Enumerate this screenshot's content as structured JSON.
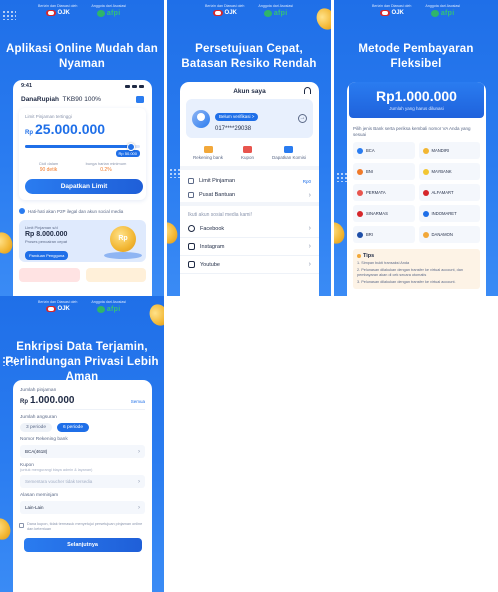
{
  "logos": {
    "ojk_caption": "Berizin dan Diawasi oleh",
    "ojk_text": "OJK",
    "afpi_caption": "Anggota dari Asosiasi",
    "afpi_text": "afpi"
  },
  "colors": {
    "accent": "#1f6fe8",
    "panel_bg": "#2a7cf0",
    "warning": "#f07a2a",
    "afpi_green": "#34c278",
    "coin": "#f2b632"
  },
  "panel1": {
    "headline_1": "Aplikasi Online Mudah dan",
    "headline_2": "Nyaman",
    "status_time": "9:41",
    "app_name": "DanaRupiah",
    "app_code": "TKB90 100%",
    "limit_label": "Limit Pinjaman tertinggi",
    "currency": "Rp",
    "limit_value": "25.000.000",
    "slider_max": "Rp 50.000",
    "slider_fraction": 0.92,
    "stat_left_label": "Cicil dalam",
    "stat_left_value": "90 detik",
    "stat_right_label": "bunga harian minimum",
    "stat_right_value": "0.2%",
    "button": "Dapatkan Limit",
    "notice": "Hati-hati akan P2P ilegal dan akun social media",
    "promo_label": "Limit Pinjaman s/d",
    "promo_value": "Rp 8.000.000",
    "promo_sub": "Proses pencairan cepat",
    "promo_button": "Panduan Pengguna",
    "promo_badge": "Rp"
  },
  "panel2": {
    "headline_1": "Persetujuan Cepat,",
    "headline_2": "Batasan Resiko Rendah",
    "title": "Akun saya",
    "verify": "Belum verifikasi >",
    "phone": "017****29038",
    "quick": [
      "Rekening bank",
      "Kupon",
      "Dapatkan Komisi"
    ],
    "menu_limit": "Limit Pinjaman",
    "menu_limit_tag": "Rp0",
    "menu_help": "Pusat Bantuan",
    "follow_label": "Ikuti akun sosial media kami!",
    "social": [
      "Facebook",
      "Instagram",
      "Youtube"
    ]
  },
  "panel3": {
    "headline_1": "Metode Pembayaran",
    "headline_2": "Fleksibel",
    "amount": "Rp1.000.000",
    "amount_sub": "Jumlah yang harus dilunasi",
    "hint": "Pilih jenis Bank serta periksa kembali nomor VA Anda yang sesuai",
    "banks": [
      "BCA",
      "MANDIRI",
      "BNI",
      "MAYBANK",
      "PERMATA",
      "ALFAMART",
      "SINARMAS",
      "INDOMARET",
      "BRI",
      "DANAMON"
    ],
    "tips_title": "Tips",
    "tips": [
      "1. Simpan bukti transaksi Anda",
      "2. Pelunasan dilakukan dengan transfer ke virtual account, dan pembayaran akan di cek secara otomatis",
      "3. Pelunasan dilakukan dengan transfer ke virtual account."
    ]
  },
  "panel4": {
    "headline_1": "Enkripsi Data Terjamin,",
    "headline_2": "Perlindungan Privasi Lebih Aman",
    "loan_label": "Jumlah pinjaman",
    "currency": "Rp",
    "loan_amount": "1.000.000",
    "all": "Semua",
    "period_label": "Jumlah angsuran",
    "period_a": "3 periode",
    "period_b": "6 periode",
    "bank_label": "Nomor Rekening bank",
    "bank_value": "BCA(4618)",
    "coupon_label": "Kupon",
    "coupon_note": "(untuk mengurangi biaya admin & layanan)",
    "coupon_placeholder": "Sementara voucher tidak tersedia",
    "reason_label": "Alasan meminjam",
    "reason_value": "Lain-Lain",
    "agree": "Dana kupon, tidak termasuk menyetujui persetujuan pinjaman online dan ketentuan",
    "submit": "Selanjutnya"
  }
}
